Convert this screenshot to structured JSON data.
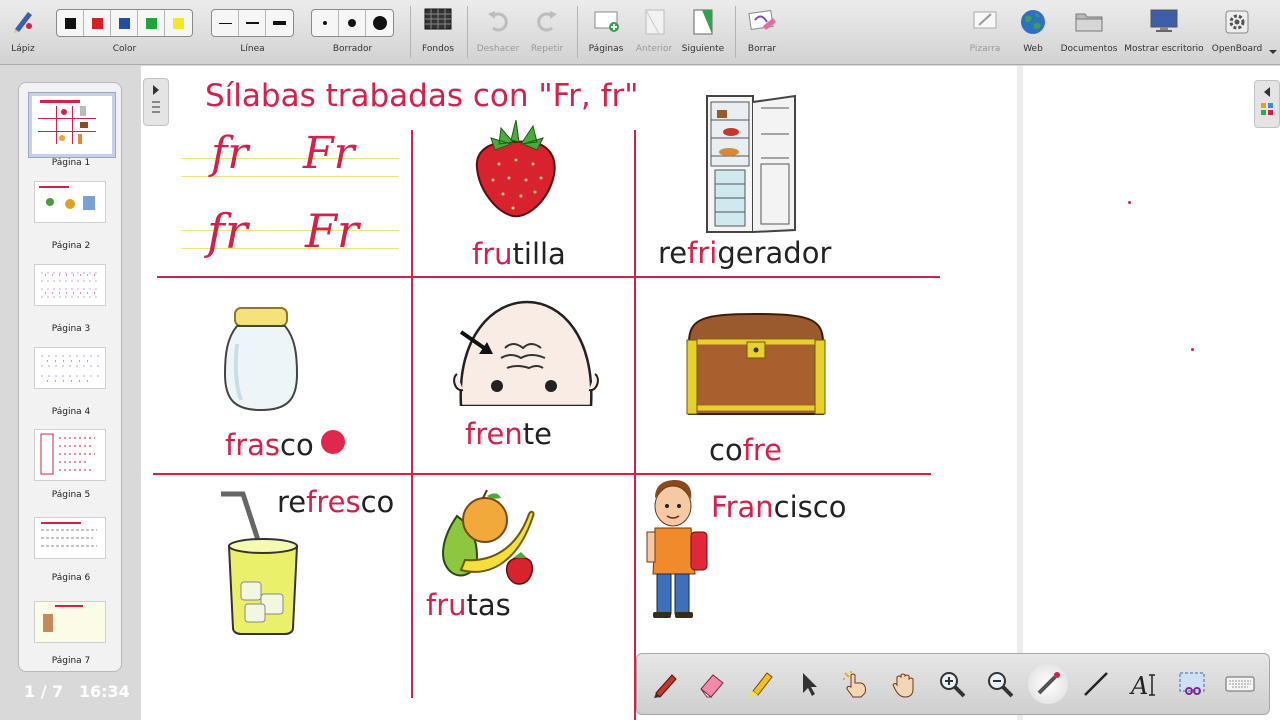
{
  "toolbar": {
    "pencil": "Lápiz",
    "color": "Color",
    "line": "Línea",
    "eraser": "Borrador",
    "backgrounds": "Fondos",
    "undo": "Deshacer",
    "redo": "Repetir",
    "pages": "Páginas",
    "previous": "Anterior",
    "next": "Siguiente",
    "clear": "Borrar",
    "board": "Pizarra",
    "web": "Web",
    "documents": "Documentos",
    "show_desktop": "Mostrar escritorio",
    "openboard": "OpenBoard",
    "colors": [
      "#111111",
      "#d61f26",
      "#1f4fa3",
      "#22a33a",
      "#f3e632"
    ]
  },
  "sidebar": {
    "pages": [
      "Página 1",
      "Página 2",
      "Página 3",
      "Página 4",
      "Página 5",
      "Página 6",
      "Página 7"
    ],
    "page_counter": "1 / 7",
    "clock": "16:34"
  },
  "board": {
    "title": "Sílabas trabadas con \"Fr, fr\"",
    "cursive": [
      "fr",
      "Fr",
      "fr",
      "Fr"
    ],
    "words": {
      "frutilla": {
        "hl": "fru",
        "rest": "tilla"
      },
      "refrigerador": {
        "pre": "re",
        "hl": "fri",
        "rest": "gerador"
      },
      "frasco": {
        "hl": "fras",
        "rest": "co"
      },
      "frente": {
        "hl": "fren",
        "rest": "te"
      },
      "cofre": {
        "pre": "co",
        "hl": "fre"
      },
      "refresco": {
        "pre": "re",
        "hl": "fres",
        "rest": "co"
      },
      "frutas": {
        "hl": "fru",
        "rest": "tas"
      },
      "francisco": {
        "hl": "Fran",
        "rest": "cisco"
      }
    }
  },
  "drawbar": {
    "tools": [
      "pen-icon",
      "eraser-icon",
      "marker-icon",
      "selector-icon",
      "interact-icon",
      "hand-icon",
      "zoom-in-icon",
      "zoom-out-icon",
      "laser-pointer-icon",
      "line-icon",
      "text-icon",
      "capture-icon",
      "keyboard-icon"
    ]
  },
  "accent": "#d4204a"
}
